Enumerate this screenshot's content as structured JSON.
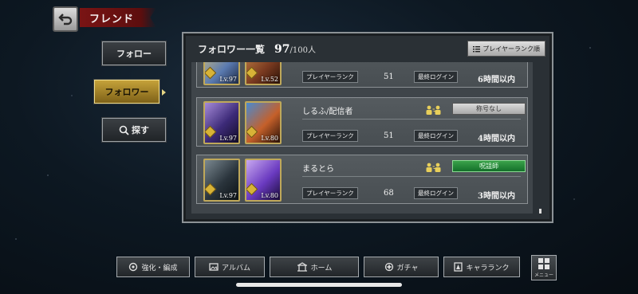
{
  "header": {
    "title": "フレンド",
    "back_icon": "back-arrow-icon"
  },
  "side_nav": [
    {
      "label": "フォロー",
      "active": false
    },
    {
      "label": "フォロワー",
      "active": true
    },
    {
      "label": "探す",
      "icon": "search-icon",
      "active": false
    }
  ],
  "panel": {
    "title": "フォロワー一覧",
    "count": "97",
    "max": "/100人",
    "sort_label": "プレイヤーランク順"
  },
  "labels": {
    "player_rank": "プレイヤーランク",
    "last_login": "最終ログイン"
  },
  "rows": [
    {
      "name": "",
      "title": "",
      "rank": "51",
      "last_login": "6時間以内",
      "lv1": "Lv.97",
      "lv2": "Lv.52"
    },
    {
      "name": "しるふ/配信者",
      "title": "称号なし",
      "rank": "51",
      "last_login": "4時間以内",
      "lv1": "Lv.97",
      "lv2": "Lv.80"
    },
    {
      "name": "まるとら",
      "title": "呪詛師",
      "rank": "68",
      "last_login": "3時間以内",
      "lv1": "Lv.97",
      "lv2": "Lv.80"
    }
  ],
  "bottom_nav": [
    {
      "label": "強化・編成",
      "icon": "upgrade-icon"
    },
    {
      "label": "アルバム",
      "icon": "album-icon"
    },
    {
      "label": "ホーム",
      "icon": "home-icon"
    },
    {
      "label": "ガチャ",
      "icon": "gacha-icon"
    },
    {
      "label": "キャラランク",
      "icon": "character-rank-icon"
    }
  ],
  "menu": {
    "label": "メニュー",
    "icon": "grid-menu-icon"
  },
  "colors": {
    "title_banner": "#6e1212",
    "active_tab": "#c5a23a",
    "green_title": "#2a8a3a"
  }
}
